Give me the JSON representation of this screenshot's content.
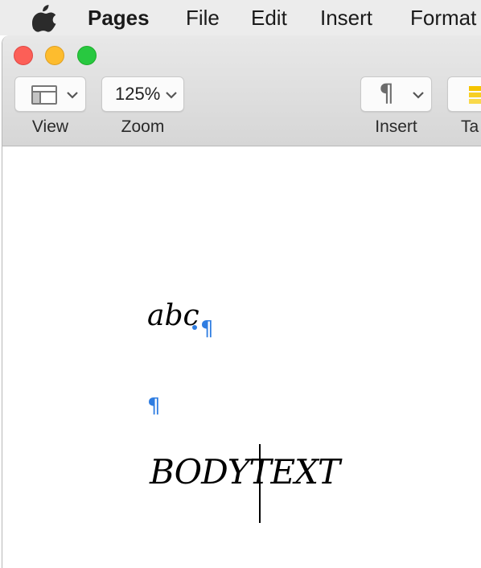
{
  "menubar": {
    "app_name": "Pages",
    "items": [
      "File",
      "Edit",
      "Insert",
      "Format"
    ]
  },
  "toolbar": {
    "view_label": "View",
    "zoom_label": "Zoom",
    "zoom_value": "125%",
    "insert_label": "Insert",
    "table_label_partial": "Ta"
  },
  "document": {
    "line1": "abc",
    "line2": "BODYTEXT",
    "pilcrow": "¶"
  },
  "colors": {
    "invisibles": "#2f7de1",
    "close": "#fc5f57",
    "minimize": "#fdbc2e",
    "zoom": "#28c840"
  }
}
